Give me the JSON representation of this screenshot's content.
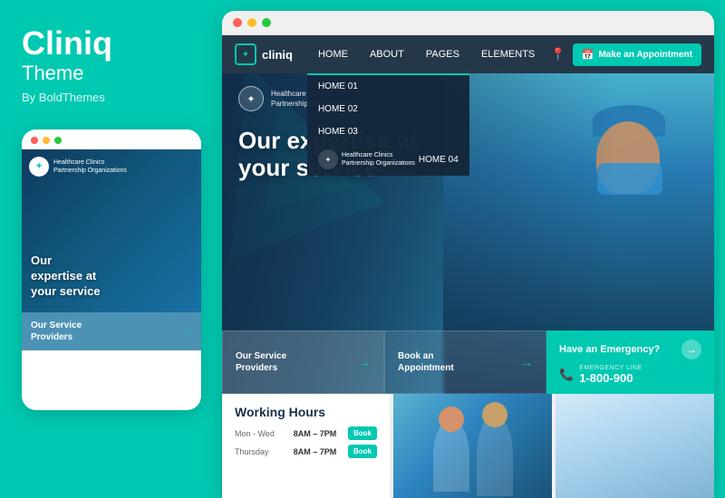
{
  "left_panel": {
    "brand_name": "Cliniq",
    "brand_subtitle": "Theme",
    "brand_by": "By BoldThemes",
    "mobile_mockup": {
      "dots": [
        "red",
        "yellow",
        "green"
      ],
      "logo_line1": "Healthcare Clinics",
      "logo_line2": "Partnership Organizations",
      "hero_text_line1": "Our",
      "hero_text_line2": "expertise at",
      "hero_text_line3": "your service",
      "service_label_line1": "Our Service",
      "service_label_line2": "Providers",
      "service_arrow": "→"
    }
  },
  "browser": {
    "dots": [
      "red",
      "yellow",
      "green"
    ]
  },
  "nav": {
    "logo_icon": "✦",
    "logo_text": "cliniq",
    "items": [
      {
        "label": "HOME",
        "active": true
      },
      {
        "label": "ABOUT"
      },
      {
        "label": "PAGES"
      },
      {
        "label": "ELEMENTS"
      }
    ],
    "pin_icon": "📍",
    "appointment_btn": "Make an Appointment",
    "calendar_icon": "📅",
    "dropdown_items": [
      "HOME 01",
      "HOME 02",
      "HOME 03",
      "HOME 04"
    ]
  },
  "hero": {
    "logo_icon": "✦",
    "logo_line1": "Healthcare Clinics",
    "logo_line2": "Partnership Organizations",
    "headline_line1": "Our expertise at",
    "headline_line2": "your service",
    "service_cards": [
      {
        "label_line1": "Our Service",
        "label_line2": "Providers",
        "arrow": "→"
      },
      {
        "label_line1": "Book an",
        "label_line2": "Appointment",
        "arrow": "→"
      }
    ],
    "emergency": {
      "title": "Have an Emergency?",
      "circle_icon": "→",
      "label": "EMERGENCY LINE",
      "phone_icon": "📞",
      "number": "1-800-900"
    }
  },
  "bottom": {
    "working_hours": {
      "title": "Working Hours",
      "rows": [
        {
          "day": "Mon - Wed",
          "time": "8AM – 7PM",
          "btn": "Book"
        },
        {
          "day": "Thursday",
          "time": "8AM – 7PM",
          "btn": "Book"
        }
      ]
    }
  }
}
